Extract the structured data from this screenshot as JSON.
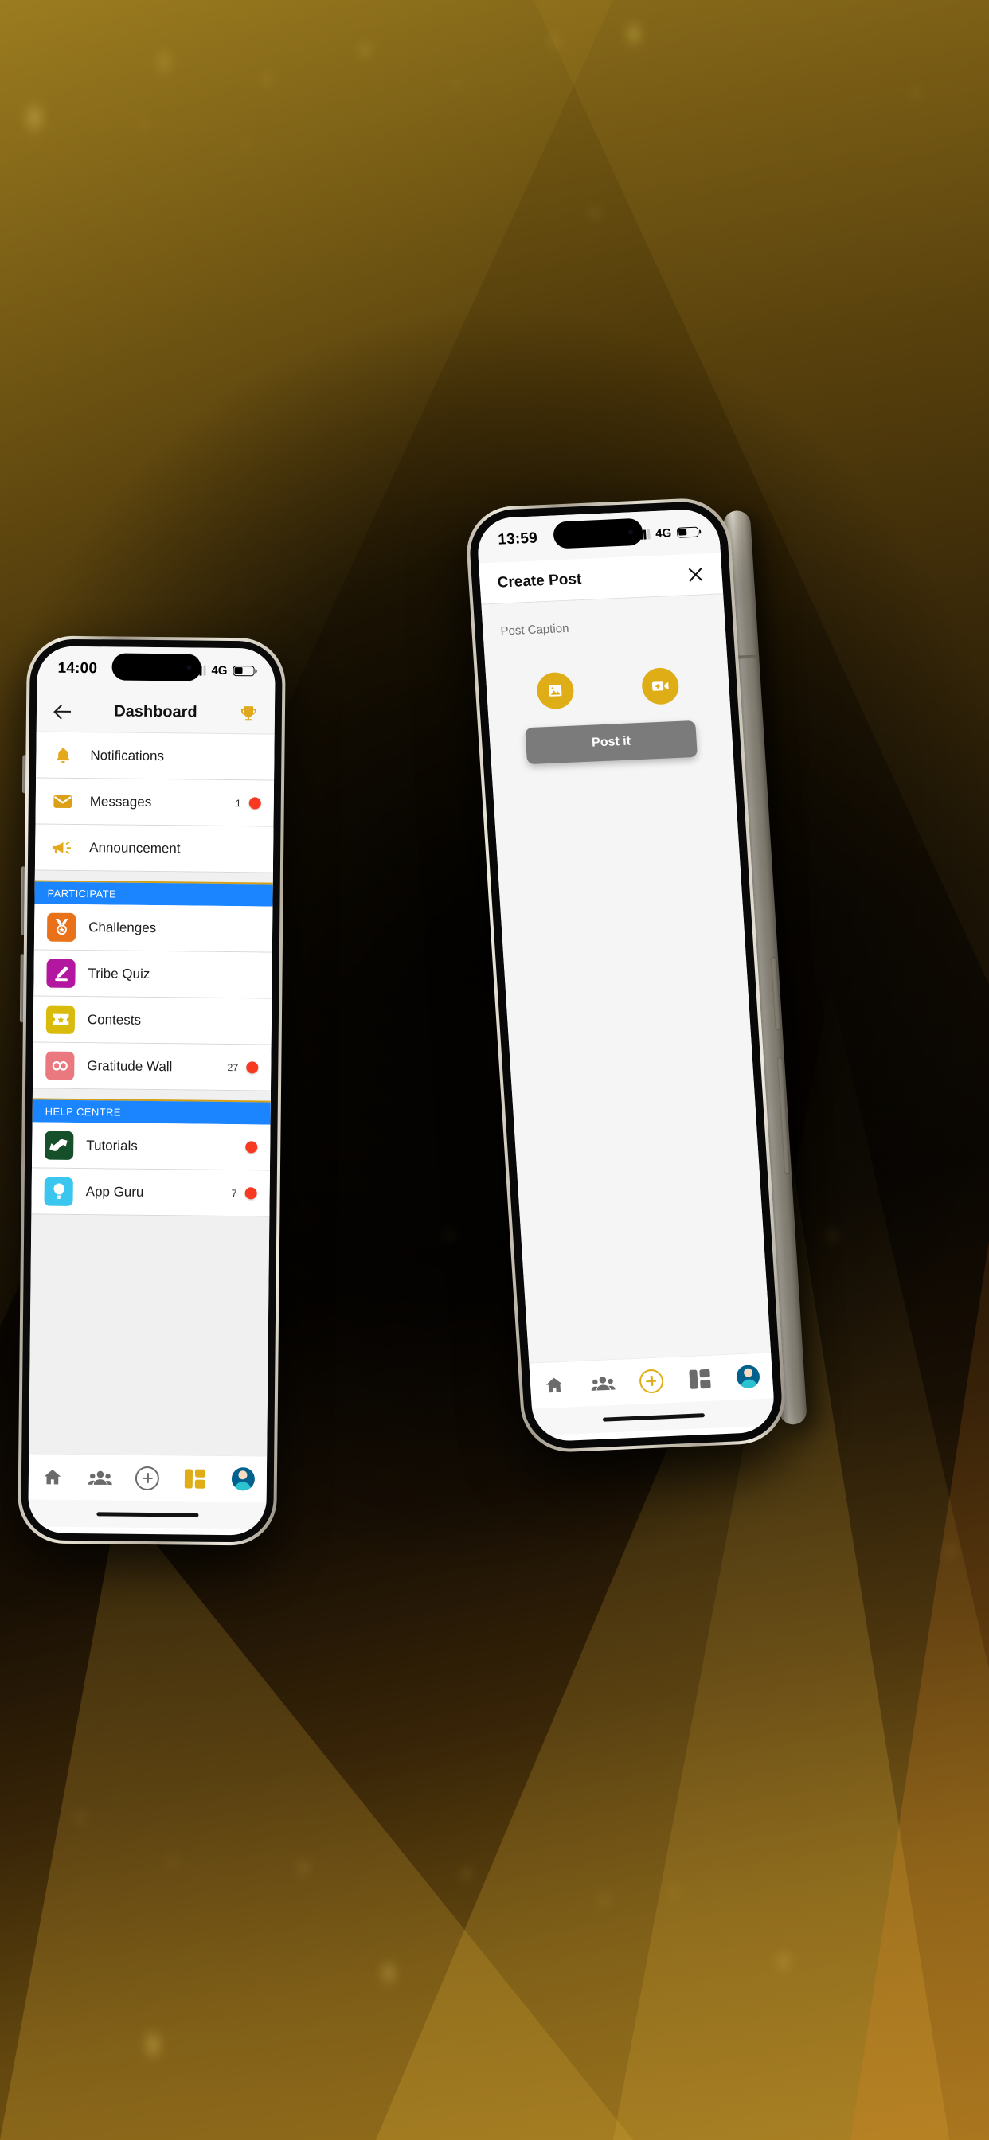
{
  "background": {
    "description": "dark amber-olive abstract gradient with bokeh light dots",
    "base_color": "#120b02",
    "accent_color": "#c69e2c"
  },
  "phones": [
    {
      "id": "left-phone",
      "device": "iphone-dashboard",
      "status_bar": {
        "time": "14:00",
        "network": "4G",
        "battery_icon": "battery-icon",
        "signal_icon": "signal-icon"
      },
      "app_bar": {
        "back_icon": "back-arrow-icon",
        "title": "Dashboard",
        "action_icon": "trophy-icon",
        "action_color": "#e0a81c"
      },
      "list": [
        {
          "type": "item",
          "name": "notifications",
          "label": "Notifications",
          "icon": "bell-icon",
          "icon_style": "plain",
          "icon_color": "#e3a91b",
          "count": "",
          "dot": false
        },
        {
          "type": "item",
          "name": "messages",
          "label": "Messages",
          "icon": "envelope-icon",
          "icon_style": "plain",
          "icon_color": "#dba017",
          "count": "1",
          "dot": true
        },
        {
          "type": "item",
          "name": "announcement",
          "label": "Announcement",
          "icon": "megaphone-icon",
          "icon_style": "plain",
          "icon_color": "#e3a91b",
          "count": "",
          "dot": false
        },
        {
          "type": "gap"
        },
        {
          "type": "section",
          "name": "participate",
          "label": "PARTICIPATE"
        },
        {
          "type": "item",
          "name": "challenges",
          "label": "Challenges",
          "icon": "medal-icon",
          "icon_style": "tile",
          "icon_color": "#e8711a",
          "count": "",
          "dot": false
        },
        {
          "type": "item",
          "name": "tribe-quiz",
          "label": "Tribe Quiz",
          "icon": "pencil-icon",
          "icon_style": "tile",
          "icon_color": "#b3179f",
          "count": "",
          "dot": false
        },
        {
          "type": "item",
          "name": "contests",
          "label": "Contests",
          "icon": "ticket-star-icon",
          "icon_style": "tile",
          "icon_color": "#d9bb0c",
          "count": "",
          "dot": false
        },
        {
          "type": "item",
          "name": "gratitude-wall",
          "label": "Gratitude Wall",
          "icon": "infinity-icon",
          "icon_style": "tile",
          "icon_color": "#e9787f",
          "count": "27",
          "dot": true
        },
        {
          "type": "gap"
        },
        {
          "type": "section",
          "name": "help-centre",
          "label": "HELP CENTRE"
        },
        {
          "type": "item",
          "name": "tutorials",
          "label": "Tutorials",
          "icon": "handshake-icon",
          "icon_style": "tile",
          "icon_color": "#15502a",
          "count": "",
          "dot": true
        },
        {
          "type": "item",
          "name": "app-guru",
          "label": "App Guru",
          "icon": "lightbulb-icon",
          "icon_style": "tile",
          "icon_color": "#3bc6f0",
          "count": "7",
          "dot": true
        }
      ],
      "tab_bar": [
        {
          "name": "tab-home",
          "icon": "home-icon",
          "active": false
        },
        {
          "name": "tab-community",
          "icon": "people-icon",
          "active": false
        },
        {
          "name": "tab-create",
          "icon": "plus-circle-icon",
          "active": false
        },
        {
          "name": "tab-dashboard",
          "icon": "dashboard-grid-icon",
          "active": true
        },
        {
          "name": "tab-profile",
          "icon": "avatar-icon",
          "active": false
        }
      ]
    },
    {
      "id": "right-phone",
      "device": "iphone-create-post",
      "status_bar": {
        "time": "13:59",
        "network": "4G",
        "battery_icon": "battery-icon",
        "signal_icon": "signal-icon"
      },
      "app_bar": {
        "title": "Create Post",
        "close_icon": "close-icon"
      },
      "form": {
        "caption_placeholder": "Post Caption",
        "caption_value": "",
        "add_photo_icon": "image-icon",
        "add_video_icon": "video-camera-plus-icon",
        "action_button_color": "#dfae17",
        "submit_label": "Post it",
        "submit_color": "#7b7b7b"
      },
      "tab_bar": [
        {
          "name": "tab-home",
          "icon": "home-icon",
          "active": false
        },
        {
          "name": "tab-community",
          "icon": "people-icon",
          "active": false
        },
        {
          "name": "tab-create",
          "icon": "plus-circle-icon",
          "active": true
        },
        {
          "name": "tab-dashboard",
          "icon": "dashboard-grid-icon",
          "active": false
        },
        {
          "name": "tab-profile",
          "icon": "avatar-icon",
          "active": false
        }
      ]
    }
  ],
  "colors": {
    "section_blue": "#1a85ff",
    "badge_red": "#f93822",
    "gold": "#dfae17",
    "divider": "#d7d7d7"
  }
}
